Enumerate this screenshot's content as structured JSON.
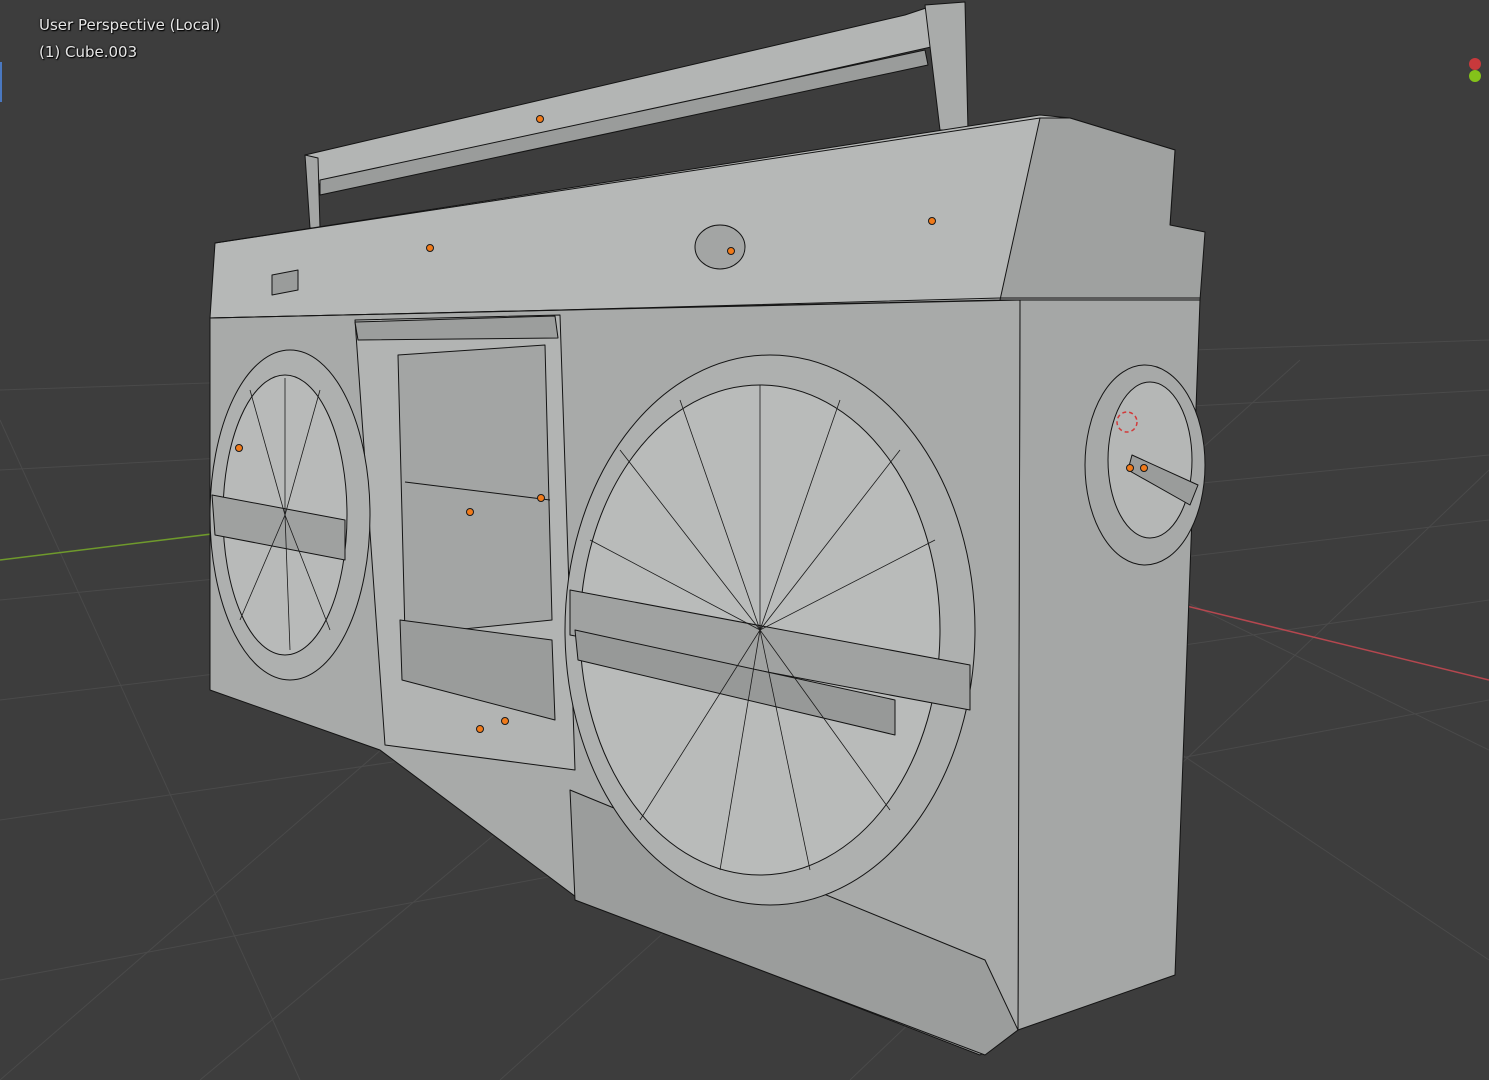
{
  "viewport": {
    "view_label": "User Perspective (Local)",
    "object_label": "(1) Cube.003"
  },
  "colors": {
    "background": "#3d3d3d",
    "grid_line": "#4a4a4a",
    "axis_x": "#b5474f",
    "axis_y": "#6f9a2c",
    "mesh_face": "#a9abaa",
    "mesh_face_light": "#bcbebd",
    "mesh_face_dark": "#8e908f",
    "wire": "#141414",
    "object_origin": "#f07a1a",
    "gizmo_x": "#c8393c",
    "gizmo_y": "#84c21a"
  },
  "gizmo": {
    "x_icon": "gizmo-x-axis-icon",
    "y_icon": "gizmo-y-axis-icon"
  }
}
